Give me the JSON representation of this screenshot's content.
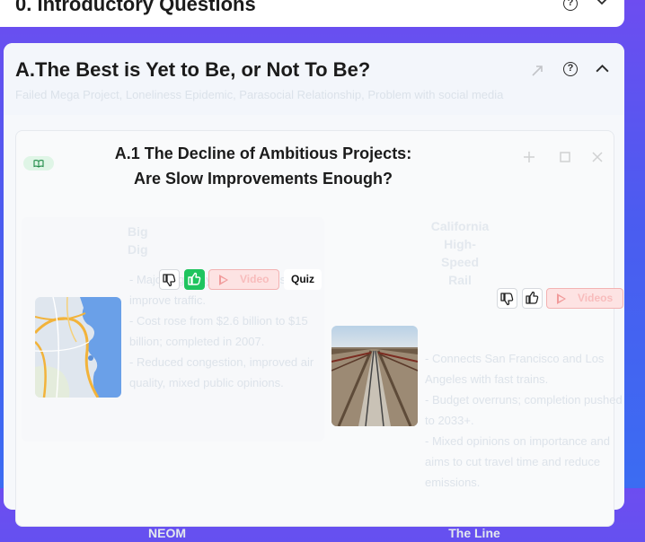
{
  "top_section": {
    "title": "0. Introductory Questions"
  },
  "section_a": {
    "title": "A.The Best is Yet to Be, or Not To Be?",
    "subtitle": "Failed Mega Project, Loneliness Epidemic, Parasocial Relationship, Problem with social media",
    "subsection": {
      "title": "A.1 The Decline of Ambitious Projects: Are Slow Improvements Enough?",
      "cards": [
        {
          "title": "Big\nDig",
          "bullets": [
            "- Major highway project in Boston to improve traffic.",
            "- Cost rose from $2.6 billion to $15 billion; completed in 2007.",
            "- Reduced congestion, improved air quality, mixed public opinions."
          ],
          "actions": {
            "video_label": "Video",
            "quiz_label": "Quiz"
          },
          "thumbs_up_selected": true
        },
        {
          "title": "California\nHigh-\nSpeed\nRail",
          "bullets": [
            "- Connects San Francisco and Los Angeles with fast trains.",
            "- Budget overruns; completion pushed to 2033+.",
            "- Mixed opinions on importance and aims to cut travel time and reduce emissions."
          ],
          "actions": {
            "video_label": "Videos"
          },
          "thumbs_up_selected": false
        }
      ],
      "next_cards_titles": [
        "NEOM",
        "The Line"
      ]
    }
  },
  "colors": {
    "accent_green": "#1fc45e",
    "video_red": "#f19b9b",
    "background_gradient_start": "#6d4df0",
    "background_gradient_end": "#3b6cf2"
  },
  "icons": [
    "help-icon",
    "chevron-up-icon",
    "chevron-down-icon",
    "share-icon",
    "book-icon",
    "thumbs-up-icon",
    "thumbs-down-icon",
    "play-icon",
    "expand-icon",
    "close-icon"
  ]
}
